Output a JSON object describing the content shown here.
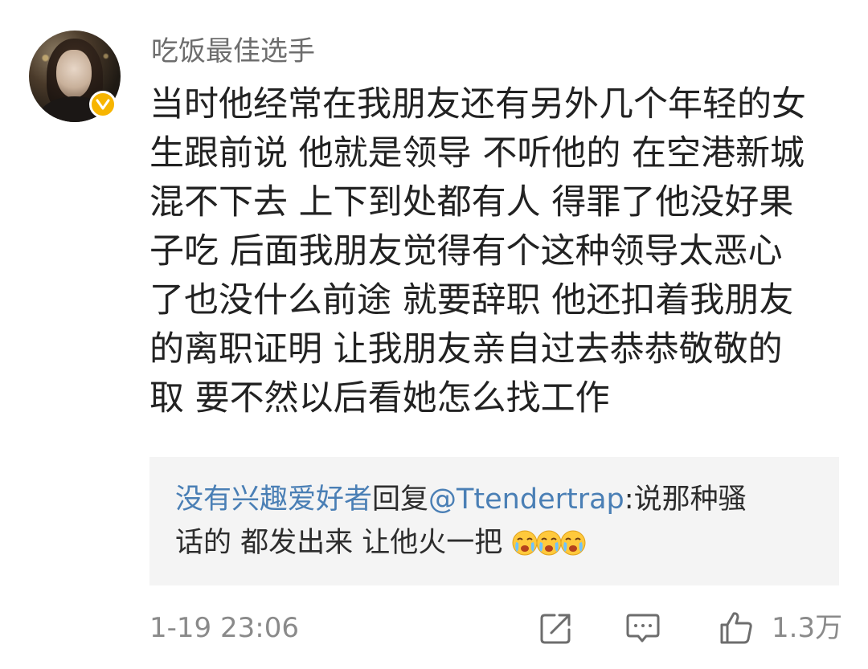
{
  "comment": {
    "username": "吃饭最佳选手",
    "verified": true,
    "badge_color": "#f7b500",
    "text_lines": [
      "当时他经常在我朋友还有另外几个年轻的女",
      "生跟前说 他就是领导 不听他的 在空港新城",
      "混不下去 上下到处都有人 得罪了他没好果",
      "子吃 后面我朋友觉得有个这种领导太恶心",
      "了也没什么前途 就要辞职 他还扣着我朋友",
      "的离职证明 让我朋友亲自过去恭恭敬敬的",
      "取 要不然以后看她怎么找工作"
    ],
    "reply": {
      "author": "没有兴趣爱好者",
      "reply_word": "回复",
      "mention": "@Ttendertrap",
      "text_after_mention": ":说那种骚",
      "line2": "话的 都发出来 让他火一把",
      "emojis": [
        "crying-face-icon",
        "crying-face-icon",
        "crying-face-icon"
      ],
      "link_color": "#4a7fb5"
    },
    "timestamp": "1-19 23:06",
    "likes": "1.3万",
    "actions": [
      "share-icon",
      "comment-icon",
      "like-icon"
    ]
  }
}
